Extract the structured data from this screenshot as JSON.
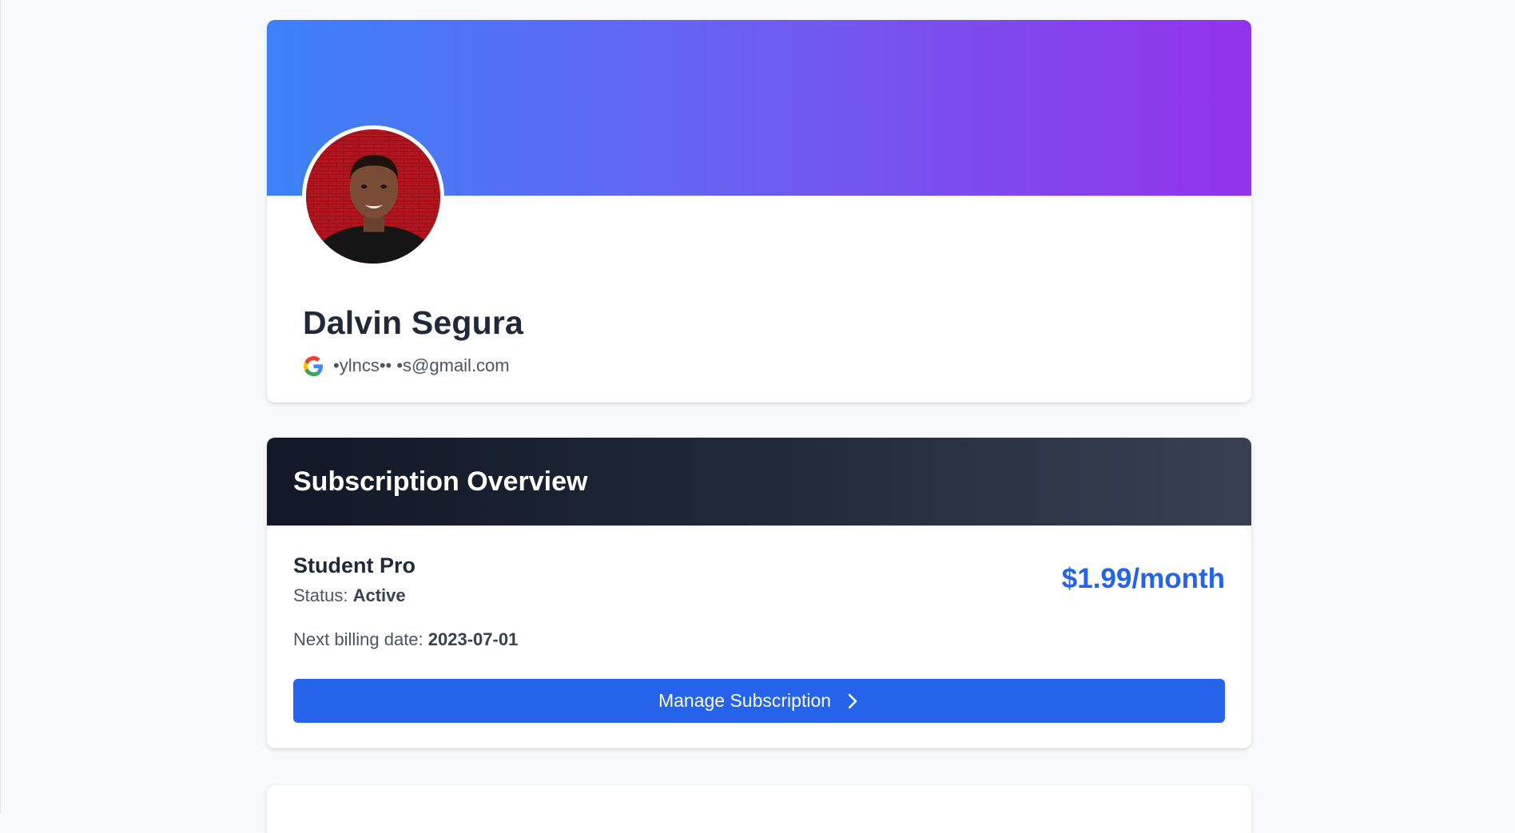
{
  "profile": {
    "name": "Dalvin Segura",
    "email": "•ylncs•• •s@gmail.com",
    "email_provider_icon": "google-icon"
  },
  "subscription": {
    "title": "Subscription Overview",
    "plan_name": "Student Pro",
    "status_label": "Status: ",
    "status_value": "Active",
    "price": "$1.99/month",
    "billing_label": "Next billing date: ",
    "billing_date": "2023-07-01",
    "manage_button_label": "Manage Subscription",
    "manage_button_icon": "chevron-right-icon"
  },
  "colors": {
    "banner_start": "#3b82f6",
    "banner_end": "#9333ea",
    "header_dark": "#111827",
    "accent": "#2563eb"
  }
}
